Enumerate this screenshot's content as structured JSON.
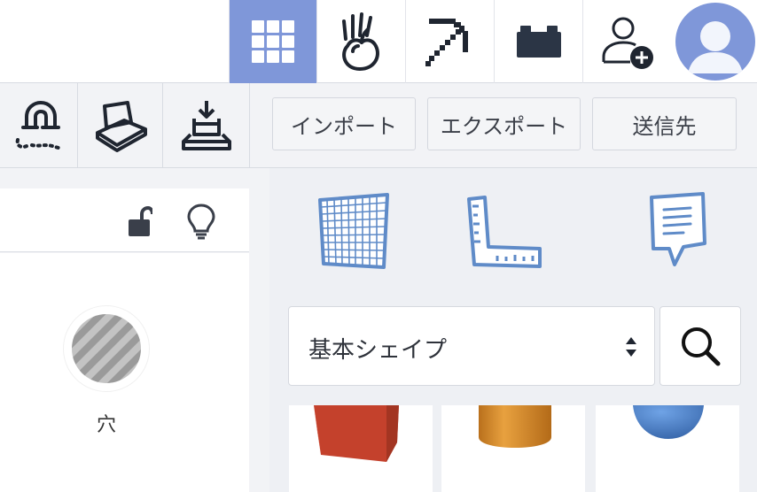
{
  "topbar": {
    "icons": [
      "grid-view-icon",
      "apple-hand-icon",
      "pickaxe-icon",
      "brick-icon",
      "add-user-icon",
      "user-avatar-icon"
    ],
    "active_color": "#7f97d9"
  },
  "toolbar": {
    "tools": [
      "magnet-icon",
      "workplane-tool-icon",
      "drop-to-workplane-icon"
    ],
    "import_label": "インポート",
    "export_label": "エクスポート",
    "send_to_label": "送信先"
  },
  "inspector": {
    "icons": [
      "unlock-icon",
      "lightbulb-icon"
    ],
    "hole_label": "穴"
  },
  "shapes_panel": {
    "tools": [
      "workplane-grid-icon",
      "ruler-icon",
      "note-icon"
    ],
    "category_selected": "基本シェイプ",
    "shapes": [
      "box-shape",
      "cylinder-shape",
      "sphere-shape"
    ],
    "colors": {
      "box": "#c4412c",
      "cylinder": "#d98b2b",
      "sphere": "#4a7fc8",
      "tool_icon": "#5f8bc8"
    }
  }
}
